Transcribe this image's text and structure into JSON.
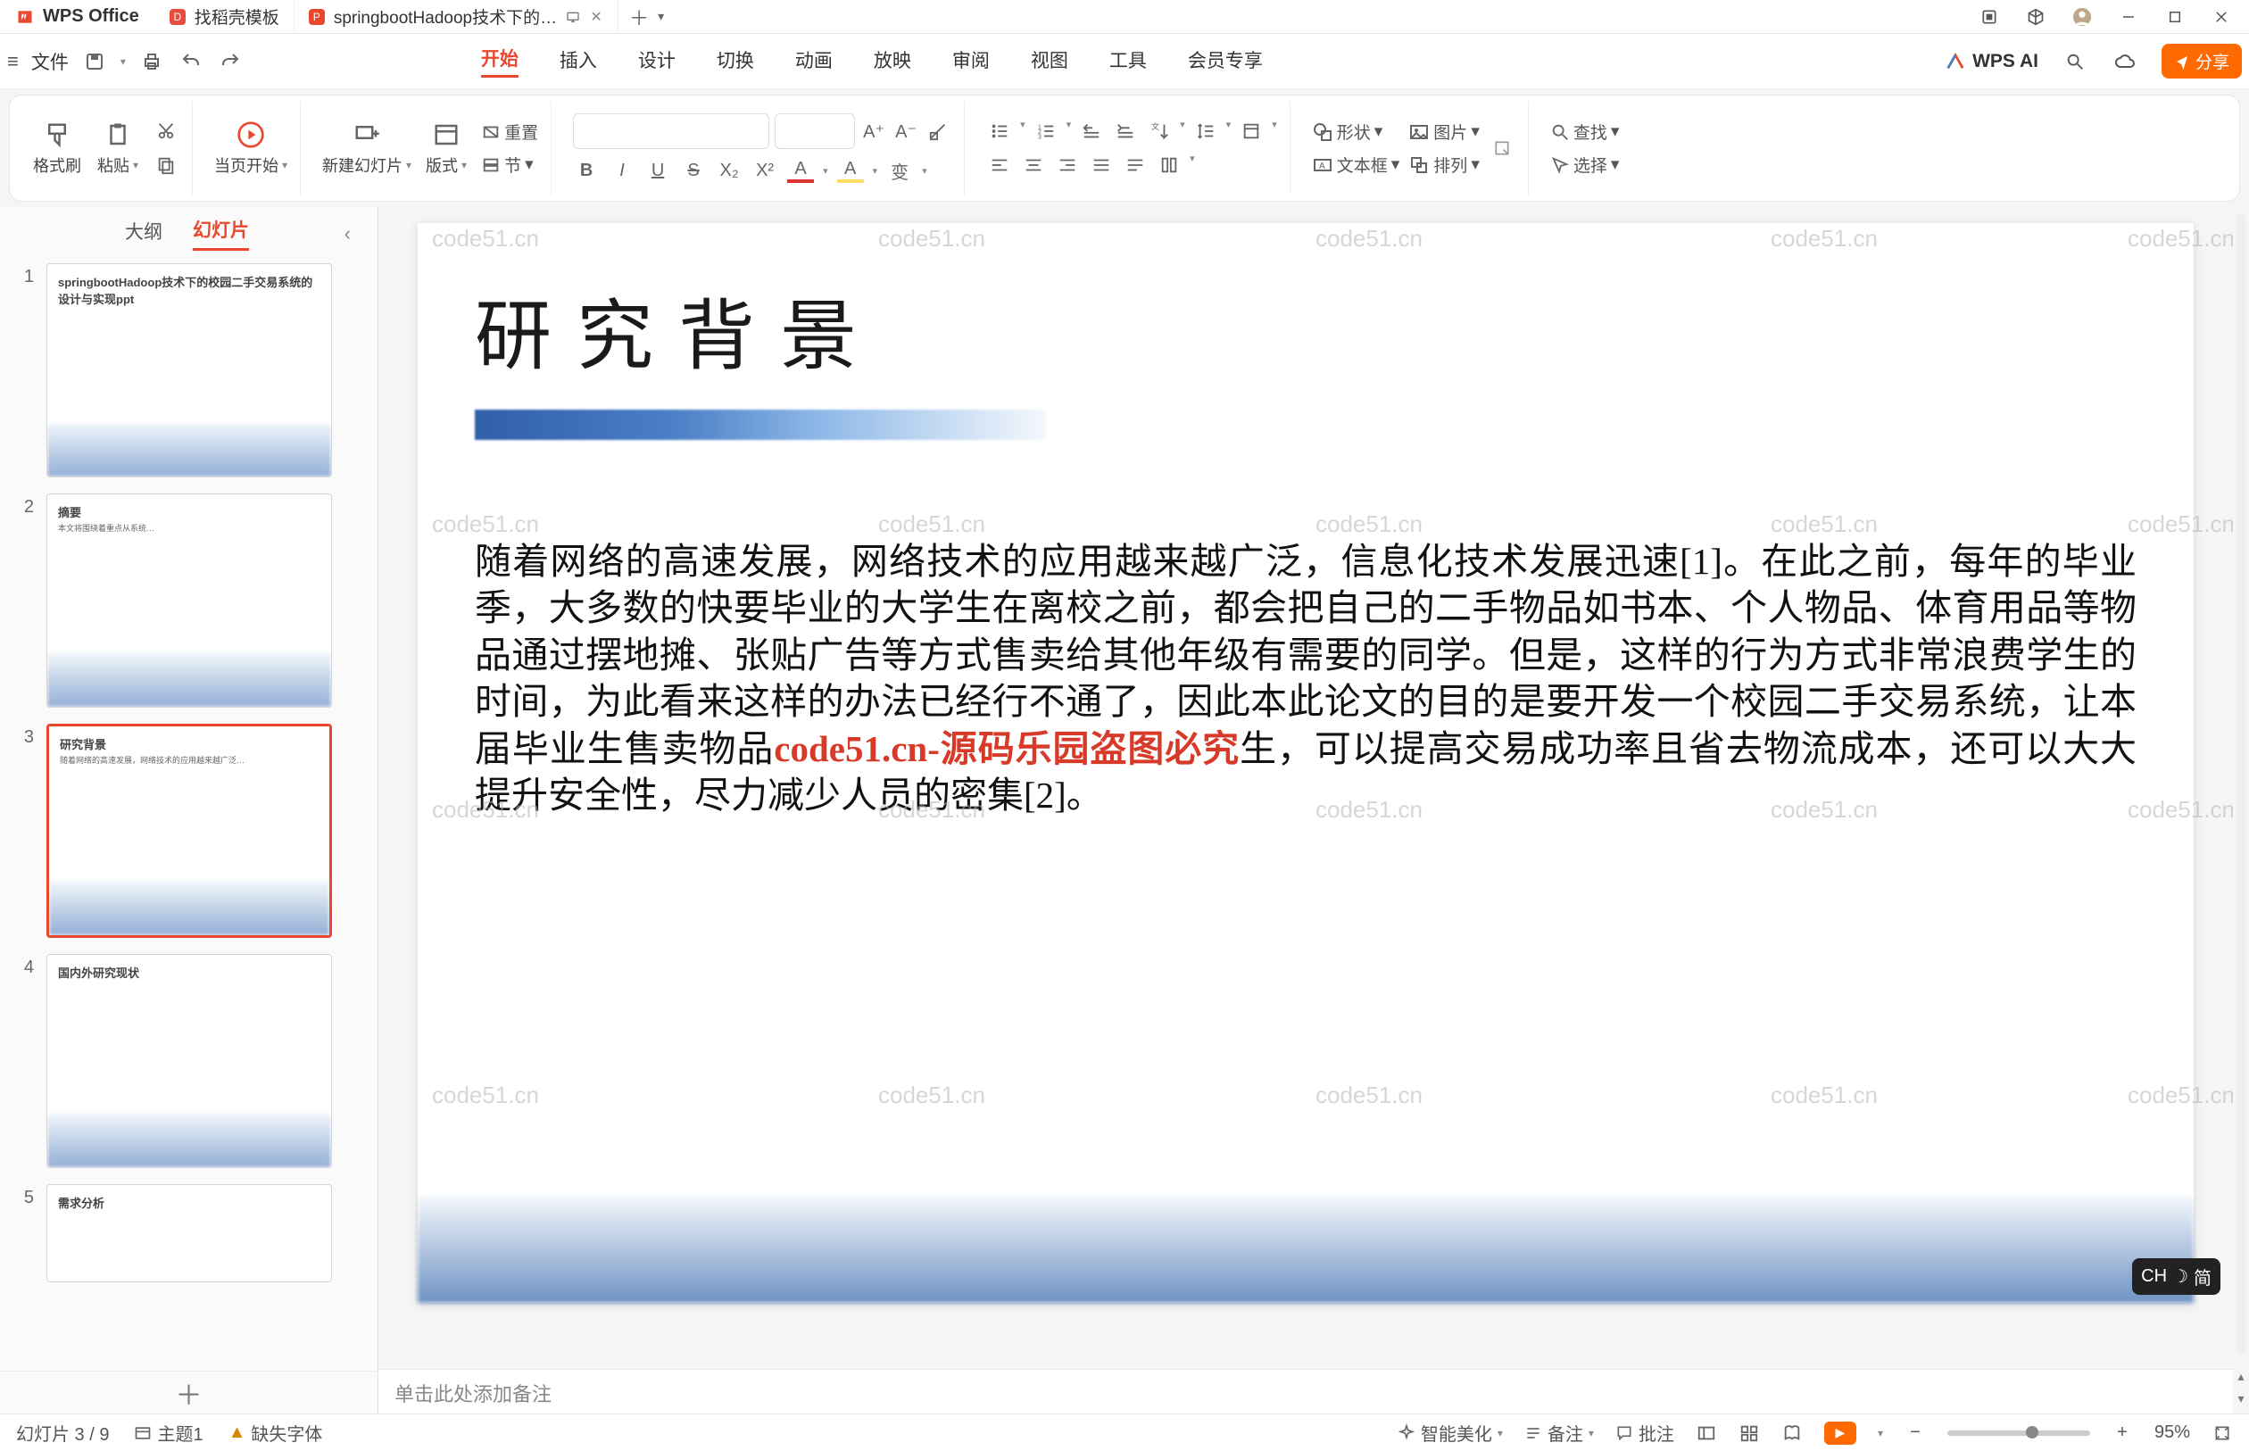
{
  "app": {
    "name": "WPS Office"
  },
  "tabs": [
    {
      "icon_color": "#e74c3c",
      "label": "找稻壳模板"
    },
    {
      "icon_color": "#e9482f",
      "label": "springbootHadoop技术下的…",
      "misc_icon": true,
      "closable": true
    }
  ],
  "menubar": {
    "file": "文件",
    "items": [
      "开始",
      "插入",
      "设计",
      "切换",
      "动画",
      "放映",
      "审阅",
      "视图",
      "工具",
      "会员专享"
    ],
    "active_index": 0,
    "wpsai": "WPS AI",
    "share": "分享"
  },
  "ribbon": {
    "format_painter": "格式刷",
    "paste": "粘贴",
    "cut_tip": "剪切",
    "from_current": "当页开始",
    "new_slide": "新建幻灯片",
    "layout": "版式",
    "section": "节",
    "reset": "重置",
    "text_effect": "变",
    "shape": "形状",
    "picture": "图片",
    "textbox": "文本框",
    "arrange": "排列",
    "find": "查找",
    "select": "选择"
  },
  "sidepanel": {
    "tab_outline": "大纲",
    "tab_slides": "幻灯片",
    "slides": [
      {
        "n": 1,
        "title": "springbootHadoop技术下的校园二手交易系统的设计与实现ppt"
      },
      {
        "n": 2,
        "title": "摘要"
      },
      {
        "n": 3,
        "title": "研究背景"
      },
      {
        "n": 4,
        "title": "国内外研究现状"
      },
      {
        "n": 5,
        "title": "需求分析"
      }
    ],
    "selected": 3
  },
  "slide": {
    "title": "研究背景",
    "body_a": "随着网络的高速发展，网络技术的应用越来越广泛，信息化技术发展迅速[1]。在此之前，每年的毕业季，大多数的快要毕业的大学生在离校之前，都会把自己的二手物品如书本、个人物品、体育用品等物品通过摆地摊、张贴广告等方式售卖给其他年级有需要的同学。但是，这样的行为方式非常浪费学生的时间，为此看来这样的办法已经行不通了，因此本此论文的目的是要开发一个校园二手交易系统，让本届毕业生售卖物品",
    "body_red": "code51.cn-源码乐园盗图必究",
    "body_b": "生，可以提高交易成功率且省去物流成本，还可以大大提升安全性，尽力减少人员的密集[2]。"
  },
  "notes_placeholder": "单击此处添加备注",
  "status": {
    "slide_counter": "幻灯片 3 / 9",
    "theme": "主题1",
    "missing_font": "缺失字体",
    "smart_beautify": "智能美化",
    "notes": "备注",
    "comments": "批注",
    "zoom_pct": "95%"
  },
  "ime": {
    "lang": "CH",
    "mode": "简"
  },
  "watermark": "code51.cn"
}
